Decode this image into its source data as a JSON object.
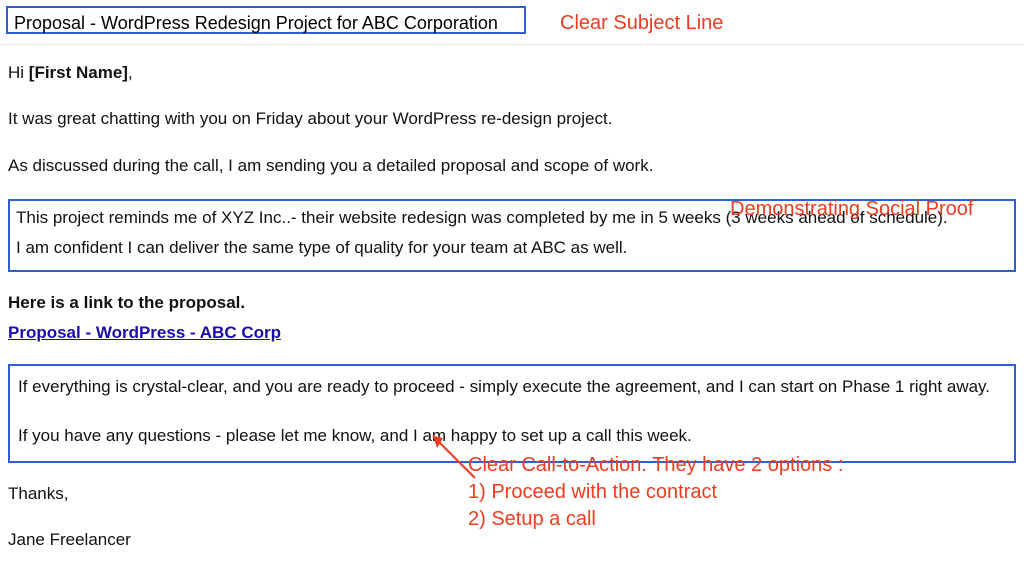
{
  "subject": "Proposal - WordPress Redesign Project for ABC Corporation",
  "greeting_prefix": "Hi ",
  "greeting_placeholder": "[First Name]",
  "greeting_suffix": ",",
  "para_intro": "It was great chatting with you on Friday about your WordPress re-design project.",
  "para_followup": "As discussed during the call, I am sending you a detailed proposal and scope of work.",
  "social_proof_line1": "This project reminds me of XYZ Inc..- their website redesign was completed by me in 5 weeks (3 weeks ahead of schedule).",
  "social_proof_line2": "I am confident I can deliver the same type of quality for your team at ABC as well.",
  "proposal_intro": "Here is a link to the proposal.",
  "proposal_link_text": "Proposal - WordPress - ABC Corp",
  "cta_line1": "If everything is crystal-clear, and you are ready to proceed - simply execute the agreement, and I can start on Phase 1 right away.",
  "cta_line2": "If you have any questions - please let me know, and I am happy to set up a call this week.",
  "thanks": "Thanks,",
  "signature": "Jane Freelancer",
  "ann_subject": "Clear Subject Line",
  "ann_social": "Demonstrating Social Proof",
  "ann_cta_header": "Clear Call-to-Action. They have 2 options :",
  "ann_cta_opt1": "1) Proceed with the contract",
  "ann_cta_opt2": "2) Setup a call"
}
